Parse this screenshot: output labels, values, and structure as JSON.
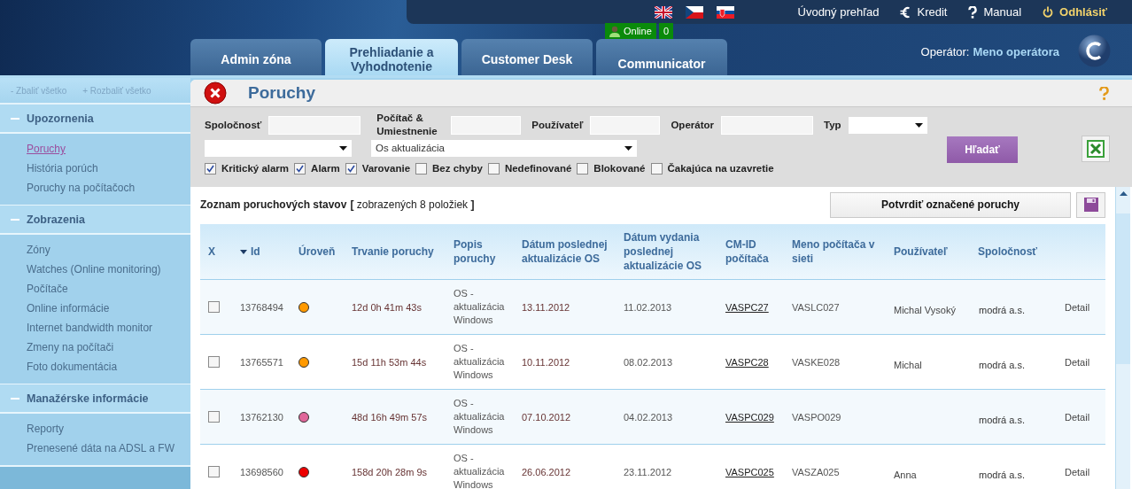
{
  "top_links": [
    {
      "kind": "home",
      "label": "Úvodný prehľad"
    },
    {
      "kind": "credit",
      "label": "Kredit"
    },
    {
      "kind": "help",
      "label": "Manual"
    },
    {
      "kind": "logout",
      "label": "Odhlásiť"
    }
  ],
  "tabs": [
    {
      "label": "Admin zóna",
      "selected": false
    },
    {
      "label": "Prehliadanie a Vyhodnotenie",
      "selected": true
    },
    {
      "label": "Customer Desk",
      "selected": false
    },
    {
      "label": "Communicator",
      "selected": false,
      "badge": {
        "label": "Online",
        "count": "0"
      }
    }
  ],
  "operator": {
    "label": "Operátor:",
    "name": "Meno operátora"
  },
  "sidebar": {
    "collapse_all": "- Zbaliť všetko",
    "expand_all": "+ Rozbaliť všetko",
    "sections": [
      {
        "title": "Upozornenia",
        "expanded": true,
        "items": [
          {
            "label": "Poruchy",
            "selected": true
          },
          {
            "label": "História porúch",
            "selected": false
          },
          {
            "label": "Poruchy na počítačoch",
            "selected": false
          }
        ]
      },
      {
        "title": "Zobrazenia",
        "expanded": true,
        "items": [
          {
            "label": "Zóny",
            "selected": false
          },
          {
            "label": "Watches (Online monitoring)",
            "selected": false
          },
          {
            "label": "Počítače",
            "selected": false
          },
          {
            "label": "Online informácie",
            "selected": false
          },
          {
            "label": "Internet bandwidth monitor",
            "selected": false
          },
          {
            "label": "Zmeny na počítači",
            "selected": false
          },
          {
            "label": "Foto dokumentácia",
            "selected": false
          }
        ]
      },
      {
        "title": "Manažérske informácie",
        "expanded": true,
        "items": [
          {
            "label": "Reporty",
            "selected": false
          },
          {
            "label": "Prenesené dáta na ADSL a FW",
            "selected": false
          }
        ]
      }
    ]
  },
  "page": {
    "title": "Poruchy"
  },
  "filter_rows": [
    [
      {
        "kind": "text",
        "label": "Spoločnosť"
      },
      {
        "kind": "text",
        "label": "Počítač & Umiestnenie"
      },
      {
        "kind": "text",
        "label": "Používateľ"
      },
      {
        "kind": "text",
        "label": "Operátor"
      },
      {
        "kind": "select",
        "label": "Typ"
      }
    ],
    [
      {
        "kind": "select"
      },
      {
        "kind": "select",
        "value": "Os aktualizácia"
      }
    ]
  ],
  "checkboxes": [
    {
      "label": "Kritický alarm",
      "checked": true
    },
    {
      "label": "Alarm",
      "checked": true
    },
    {
      "label": "Varovanie",
      "checked": true
    },
    {
      "label": "Bez chyby",
      "checked": false
    },
    {
      "label": "Nedefinované",
      "checked": false
    },
    {
      "label": "Blokované",
      "checked": false
    },
    {
      "label": "Čakajúca na uzavretie",
      "checked": false
    }
  ],
  "search_button": "Hľadať",
  "list": {
    "title": "Zoznam poruchových stavov",
    "summary": "**[** zobrazených 8 položiek **]**",
    "confirm_button": "Potvrdiť označené poruchy"
  },
  "table": {
    "columns": [
      {
        "label": "X",
        "sorted": false
      },
      {
        "label": "Id",
        "sorted": true
      },
      {
        "label": "Úroveň",
        "sorted": false
      },
      {
        "label": "Trvanie poruchy",
        "sorted": false
      },
      {
        "label": "Popis poruchy",
        "sorted": false
      },
      {
        "label": "Dátum poslednej aktualizácie OS",
        "sorted": false
      },
      {
        "label": "Dátum vydania poslednej aktualizácie OS",
        "sorted": false
      },
      {
        "label": "CM-ID počítača",
        "sorted": false
      },
      {
        "label": "Meno počítača v sieti",
        "sorted": false
      },
      {
        "label": "Používateľ",
        "sorted": false
      },
      {
        "label": "Spoločnosť",
        "sorted": false
      }
    ],
    "rows": [
      {
        "checked": false,
        "id": "13768494",
        "color": "#ff9900",
        "duration": "12d 0h 41m 43s",
        "description": "OS - aktualizácia Windows",
        "last_update": "13.11.2012",
        "release_date": "11.02.2013",
        "cm_id": "VASPC27",
        "computer_name": "VASLC027",
        "user": "Michal Vysoký",
        "company": "modrá a.s.",
        "action": "Detail"
      },
      {
        "checked": false,
        "id": "13765571",
        "color": "#ff9900",
        "duration": "15d 11h 53m 44s",
        "description": "OS - aktualizácia Windows",
        "last_update": "10.11.2012",
        "release_date": "08.02.2013",
        "cm_id": "VASPC28",
        "computer_name": "VASKE028",
        "user": "Michal",
        "company": "modrá a.s.",
        "action": "Detail"
      },
      {
        "checked": false,
        "id": "13762130",
        "color": "#e0679a",
        "duration": "48d 16h 49m 57s",
        "description": "OS - aktualizácia Windows",
        "last_update": "07.10.2012",
        "release_date": "04.02.2013",
        "cm_id": "VASPC029",
        "computer_name": "VASPO029",
        "company": "modrá a.s.",
        "action": "Detail"
      },
      {
        "checked": false,
        "id": "13698560",
        "color": "#ee0000",
        "duration": "158d 20h 28m 9s",
        "description": "OS - aktualizácia Windows",
        "last_update": "26.06.2012",
        "release_date": "23.11.2012",
        "cm_id": "VASPC025",
        "computer_name": "VASZA025",
        "user": "Anna",
        "company": "modrá a.s.",
        "action": "Detail"
      }
    ]
  }
}
